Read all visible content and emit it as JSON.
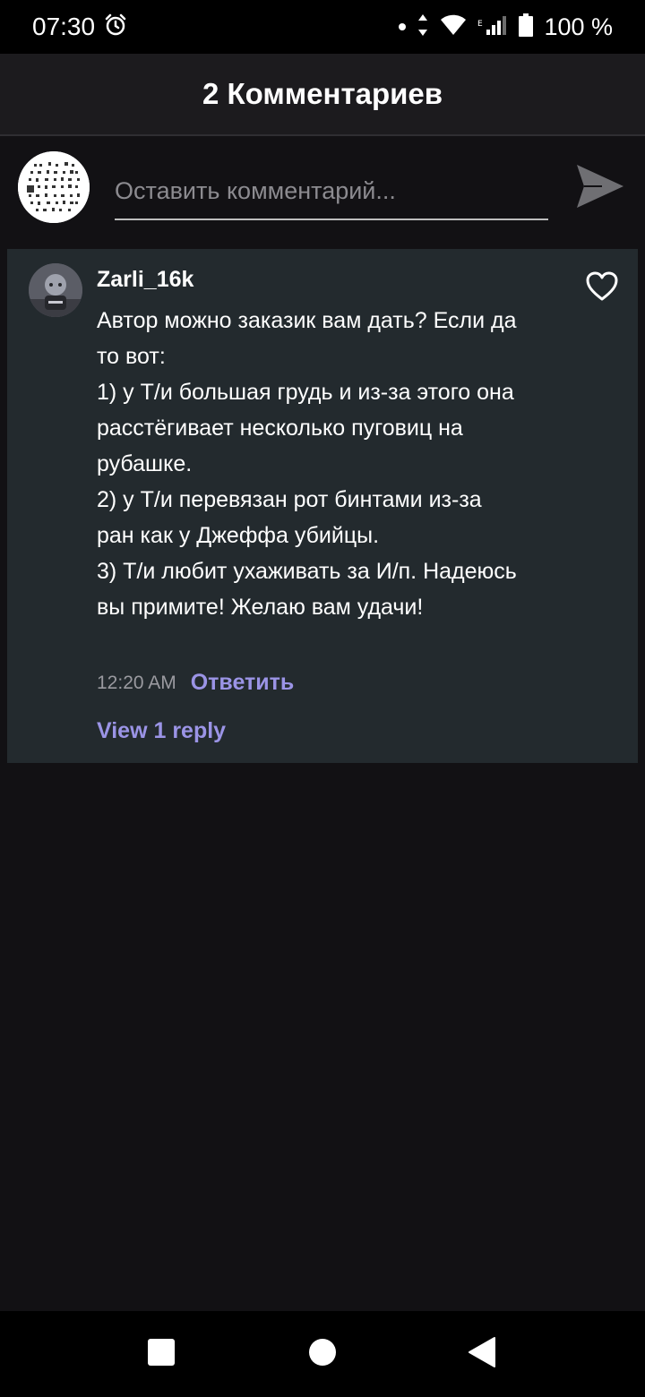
{
  "status_bar": {
    "time": "07:30",
    "battery": "100 %"
  },
  "header": {
    "title": "2 Комментариев"
  },
  "composer": {
    "placeholder": "Оставить комментарий..."
  },
  "comment": {
    "username": "Zarli_16k",
    "text": "Автор можно заказик вам дать? Если да то вот:\n1) у Т/и большая грудь и из-за этого она расстёгивает несколько пуговиц на рубашке.\n2) у Т/и перевязан рот бинтами из-за ран как у Джеффа убийцы.\n3) Т/и любит ухаживать за И/п. Надеюсь вы примите! Желаю вам удачи!",
    "time": "12:20 AM",
    "reply_label": "Ответить",
    "view_replies_label": "View 1 reply"
  },
  "icons": {
    "alarm": "alarm-icon",
    "data_arrows": "data-transfer-icon",
    "wifi": "wifi-icon",
    "signal": "cell-signal-icon",
    "battery": "battery-icon",
    "send": "send-icon",
    "like": "heart-icon",
    "nav_recents": "square-icon",
    "nav_home": "circle-icon",
    "nav_back": "triangle-back-icon"
  },
  "colors": {
    "background": "#121114",
    "header": "#1c1b1e",
    "card": "#232a2e",
    "accent": "#9b94e6"
  }
}
